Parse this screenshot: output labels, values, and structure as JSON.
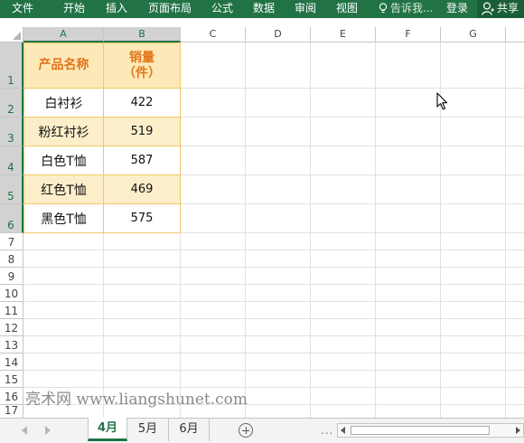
{
  "ribbon": {
    "tabs": [
      "文件",
      "开始",
      "插入",
      "页面布局",
      "公式",
      "数据",
      "审阅",
      "视图"
    ],
    "tell_me": "告诉我...",
    "signin": "登录",
    "share": "共享"
  },
  "columns": [
    "A",
    "B",
    "C",
    "D",
    "E",
    "F",
    "G"
  ],
  "rows": [
    "1",
    "2",
    "3",
    "4",
    "5",
    "6",
    "7",
    "8",
    "9",
    "10",
    "11",
    "12",
    "13",
    "14",
    "15",
    "16",
    "17"
  ],
  "table": {
    "header_name": "产品名称",
    "header_qty_line1": "销量",
    "header_qty_line2": "（件）",
    "items": [
      {
        "name": "白衬衫",
        "qty": "422"
      },
      {
        "name": "粉红衬衫",
        "qty": "519"
      },
      {
        "name": "白色T恤",
        "qty": "587"
      },
      {
        "name": "红色T恤",
        "qty": "469"
      },
      {
        "name": "黑色T恤",
        "qty": "575"
      }
    ]
  },
  "watermark": "亮术网 www.liangshunet.com",
  "sheets": [
    "4月",
    "5月",
    "6月"
  ],
  "active_sheet": "4月",
  "more": "...",
  "colors": {
    "ribbon": "#217346",
    "header_fill": "#fde9b8",
    "header_text": "#e2741a",
    "band_fill": "#fdeeca",
    "table_border": "#f2c866"
  }
}
